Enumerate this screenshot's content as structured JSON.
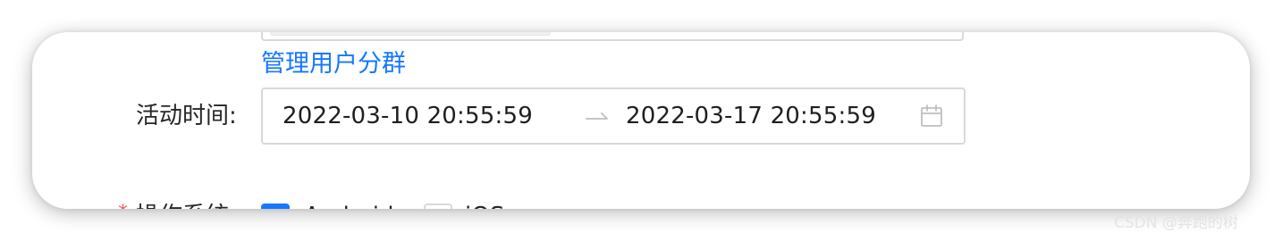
{
  "form": {
    "manage_link": "管理用户分群",
    "activity_time": {
      "label": "活动时间:",
      "start": "2022-03-10 20:55:59",
      "end": "2022-03-17 20:55:59",
      "separator_icon": "arrow-right-icon",
      "calendar_icon": "calendar-icon"
    },
    "os": {
      "required_mark": "*",
      "label": "操作系统:",
      "options": [
        {
          "label": "Android",
          "checked": true
        },
        {
          "label": "iOS",
          "checked": false
        }
      ]
    }
  },
  "watermark": "CSDN @奔跑的树",
  "colors": {
    "link": "#1677ff",
    "border": "#d9d9d9",
    "checkbox_checked": "#1677ff",
    "required": "#ff4d4f"
  }
}
